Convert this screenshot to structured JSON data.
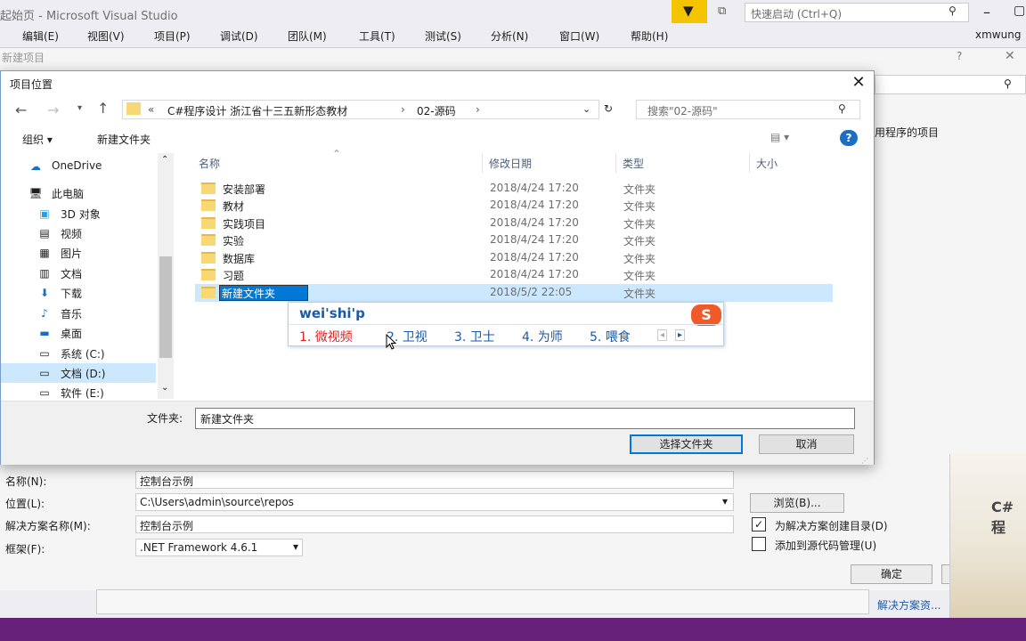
{
  "vs": {
    "title": "起始页 - Microsoft Visual Studio",
    "quick_launch": "快速启动 (Ctrl+Q)",
    "user": "xmwung",
    "menu": [
      "编辑(E)",
      "视图(V)",
      "项目(P)",
      "调试(D)",
      "团队(M)",
      "工具(T)",
      "测试(S)",
      "分析(N)",
      "窗口(W)",
      "帮助(H)"
    ]
  },
  "new_project": {
    "title": "新建项目",
    "help": "?",
    "close": "✕",
    "right_hint": "用程序的项目",
    "name_label": "名称(N):",
    "name_value": "控制台示例",
    "location_label": "位置(L):",
    "location_value": "C:\\Users\\admin\\source\\repos",
    "solution_label": "解决方案名称(M):",
    "solution_value": "控制台示例",
    "framework_label": "框架(F):",
    "framework_value": ".NET Framework 4.6.1",
    "browse": "浏览(B)...",
    "create_dir": "为解决方案创建目录(D)",
    "create_dir_checked": true,
    "add_source": "添加到源代码管理(U)",
    "add_source_checked": false,
    "ok": "确定",
    "cancel": "取消",
    "solution_explorer": "解决方案资...",
    "thumb_text": "C#程"
  },
  "dialog": {
    "title": "项目位置",
    "breadcrumb": [
      "«",
      "C#程序设计 浙江省十三五新形态教材",
      "›",
      "02-源码",
      "›"
    ],
    "search_placeholder": "搜索\"02-源码\"",
    "organize": "组织 ▾",
    "new_folder": "新建文件夹",
    "columns": [
      "名称",
      "修改日期",
      "类型",
      "大小"
    ],
    "nav": [
      {
        "icon": "☁",
        "label": "OneDrive"
      },
      {
        "icon": "🖥",
        "label": "此电脑"
      },
      {
        "icon": "▣",
        "label": "3D 对象"
      },
      {
        "icon": "▤",
        "label": "视频"
      },
      {
        "icon": "▦",
        "label": "图片"
      },
      {
        "icon": "▥",
        "label": "文档"
      },
      {
        "icon": "⬇",
        "label": "下载"
      },
      {
        "icon": "♪",
        "label": "音乐"
      },
      {
        "icon": "▬",
        "label": "桌面"
      },
      {
        "icon": "▭",
        "label": "系统 (C:)"
      },
      {
        "icon": "▭",
        "label": "文档 (D:)"
      },
      {
        "icon": "▭",
        "label": "软件 (E:)"
      }
    ],
    "rows": [
      {
        "name": "安装部署",
        "date": "2018/4/24 17:20",
        "type": "文件夹"
      },
      {
        "name": "教材",
        "date": "2018/4/24 17:20",
        "type": "文件夹"
      },
      {
        "name": "实践项目",
        "date": "2018/4/24 17:20",
        "type": "文件夹"
      },
      {
        "name": "实验",
        "date": "2018/4/24 17:20",
        "type": "文件夹"
      },
      {
        "name": "数据库",
        "date": "2018/4/24 17:20",
        "type": "文件夹"
      },
      {
        "name": "习题",
        "date": "2018/4/24 17:20",
        "type": "文件夹"
      },
      {
        "name": "新建文件夹",
        "date": "2018/5/2 22:05",
        "type": "文件夹"
      }
    ],
    "folder_label": "文件夹:",
    "folder_value": "新建文件夹",
    "select_button": "选择文件夹",
    "cancel_button": "取消"
  },
  "ime": {
    "composition": "wei'shi'p",
    "candidates": [
      "1. 微视频",
      "2. 卫视",
      "3. 卫士",
      "4. 为师",
      "5. 喂食"
    ],
    "logo": "S"
  },
  "colors": {
    "accent": "#68217a",
    "selection": "#cce8ff",
    "link": "#1b5aa8"
  }
}
